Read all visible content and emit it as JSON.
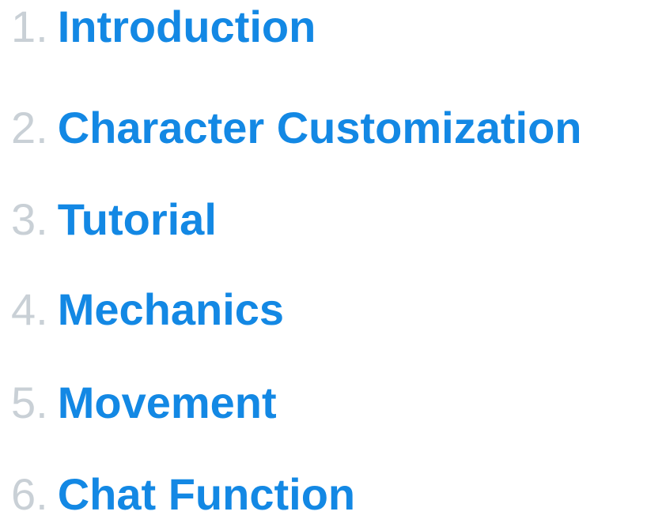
{
  "toc": {
    "accent_color": "#1388e4",
    "number_color": "#c9d0d6",
    "items": [
      {
        "number": "1",
        "title": "Introduction"
      },
      {
        "number": "2",
        "title": "Character Customization"
      },
      {
        "number": "3",
        "title": "Tutorial"
      },
      {
        "number": "4",
        "title": "Mechanics"
      },
      {
        "number": "5",
        "title": "Movement"
      },
      {
        "number": "6",
        "title": "Chat Function"
      }
    ]
  }
}
